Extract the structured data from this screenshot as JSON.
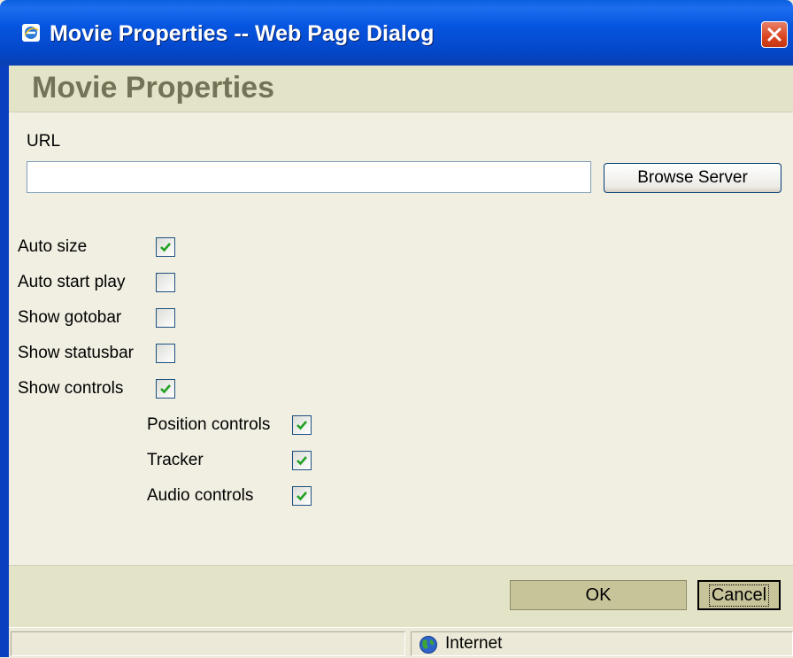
{
  "window": {
    "title": "Movie Properties -- Web Page Dialog",
    "icons": {
      "app": "ie-icon",
      "close": "close-icon"
    }
  },
  "dialog": {
    "heading": "Movie Properties",
    "url": {
      "label": "URL",
      "value": "",
      "placeholder": ""
    },
    "browse_button": "Browse Server",
    "options": [
      {
        "label": "Auto size",
        "checked": true
      },
      {
        "label": "Auto start play",
        "checked": false
      },
      {
        "label": "Show gotobar",
        "checked": false
      },
      {
        "label": "Show statusbar",
        "checked": false
      },
      {
        "label": "Show controls",
        "checked": true
      }
    ],
    "sub_options": [
      {
        "label": "Position controls",
        "checked": true
      },
      {
        "label": "Tracker",
        "checked": true
      },
      {
        "label": "Audio controls",
        "checked": true
      }
    ],
    "ok_button": "OK",
    "cancel_button": "Cancel"
  },
  "statusbar": {
    "zone": "Internet",
    "zone_icon": "globe-icon"
  },
  "colors": {
    "titlebar": "#0655E0",
    "checkmark": "#21A121",
    "heading": "#737357"
  }
}
